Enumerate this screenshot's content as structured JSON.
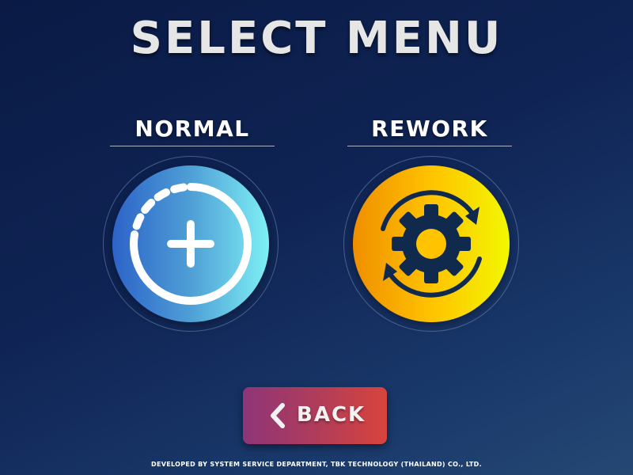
{
  "title": "SELECT MENU",
  "options": [
    {
      "label": "NORMAL",
      "icon": "add-circle-icon",
      "accent_start": "#2c63c8",
      "accent_end": "#7ef0f5"
    },
    {
      "label": "REWORK",
      "icon": "gear-cycle-icon",
      "accent_start": "#ef8e00",
      "accent_end": "#f2f700"
    }
  ],
  "back_button": {
    "label": "BACK",
    "icon": "chevron-left-icon"
  },
  "footer": "DEVELOPED BY SYSTEM SERVICE DEPARTMENT, TBK TECHNOLOGY (THAILAND) CO., LTD.",
  "colors": {
    "background": "#0f2454",
    "back_button_start": "#8e3578",
    "back_button_end": "#d8443c",
    "gear_color": "#0f2a4d"
  }
}
